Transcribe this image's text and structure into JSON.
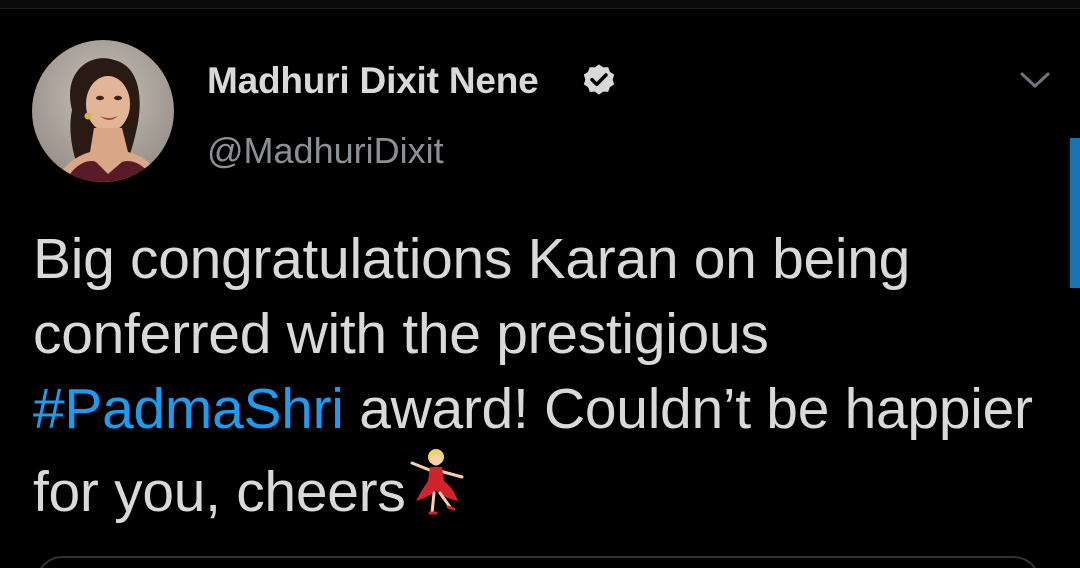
{
  "tweet": {
    "author": {
      "display_name": "Madhuri Dixit Nene",
      "handle": "@MadhuriDixit",
      "verified": true,
      "avatar_icon": "profile-photo"
    },
    "text_part1": "Big congratulations Karan on being conferred with the prestigious ",
    "hashtag": "#PadmaShri",
    "text_part2": " award! Couldn’t be happier for you, cheers",
    "emoji_icon": "dancer-emoji"
  },
  "colors": {
    "background": "#000000",
    "text": "#d9d9d9",
    "secondary_text": "#8b9097",
    "link": "#1d9bf0"
  }
}
